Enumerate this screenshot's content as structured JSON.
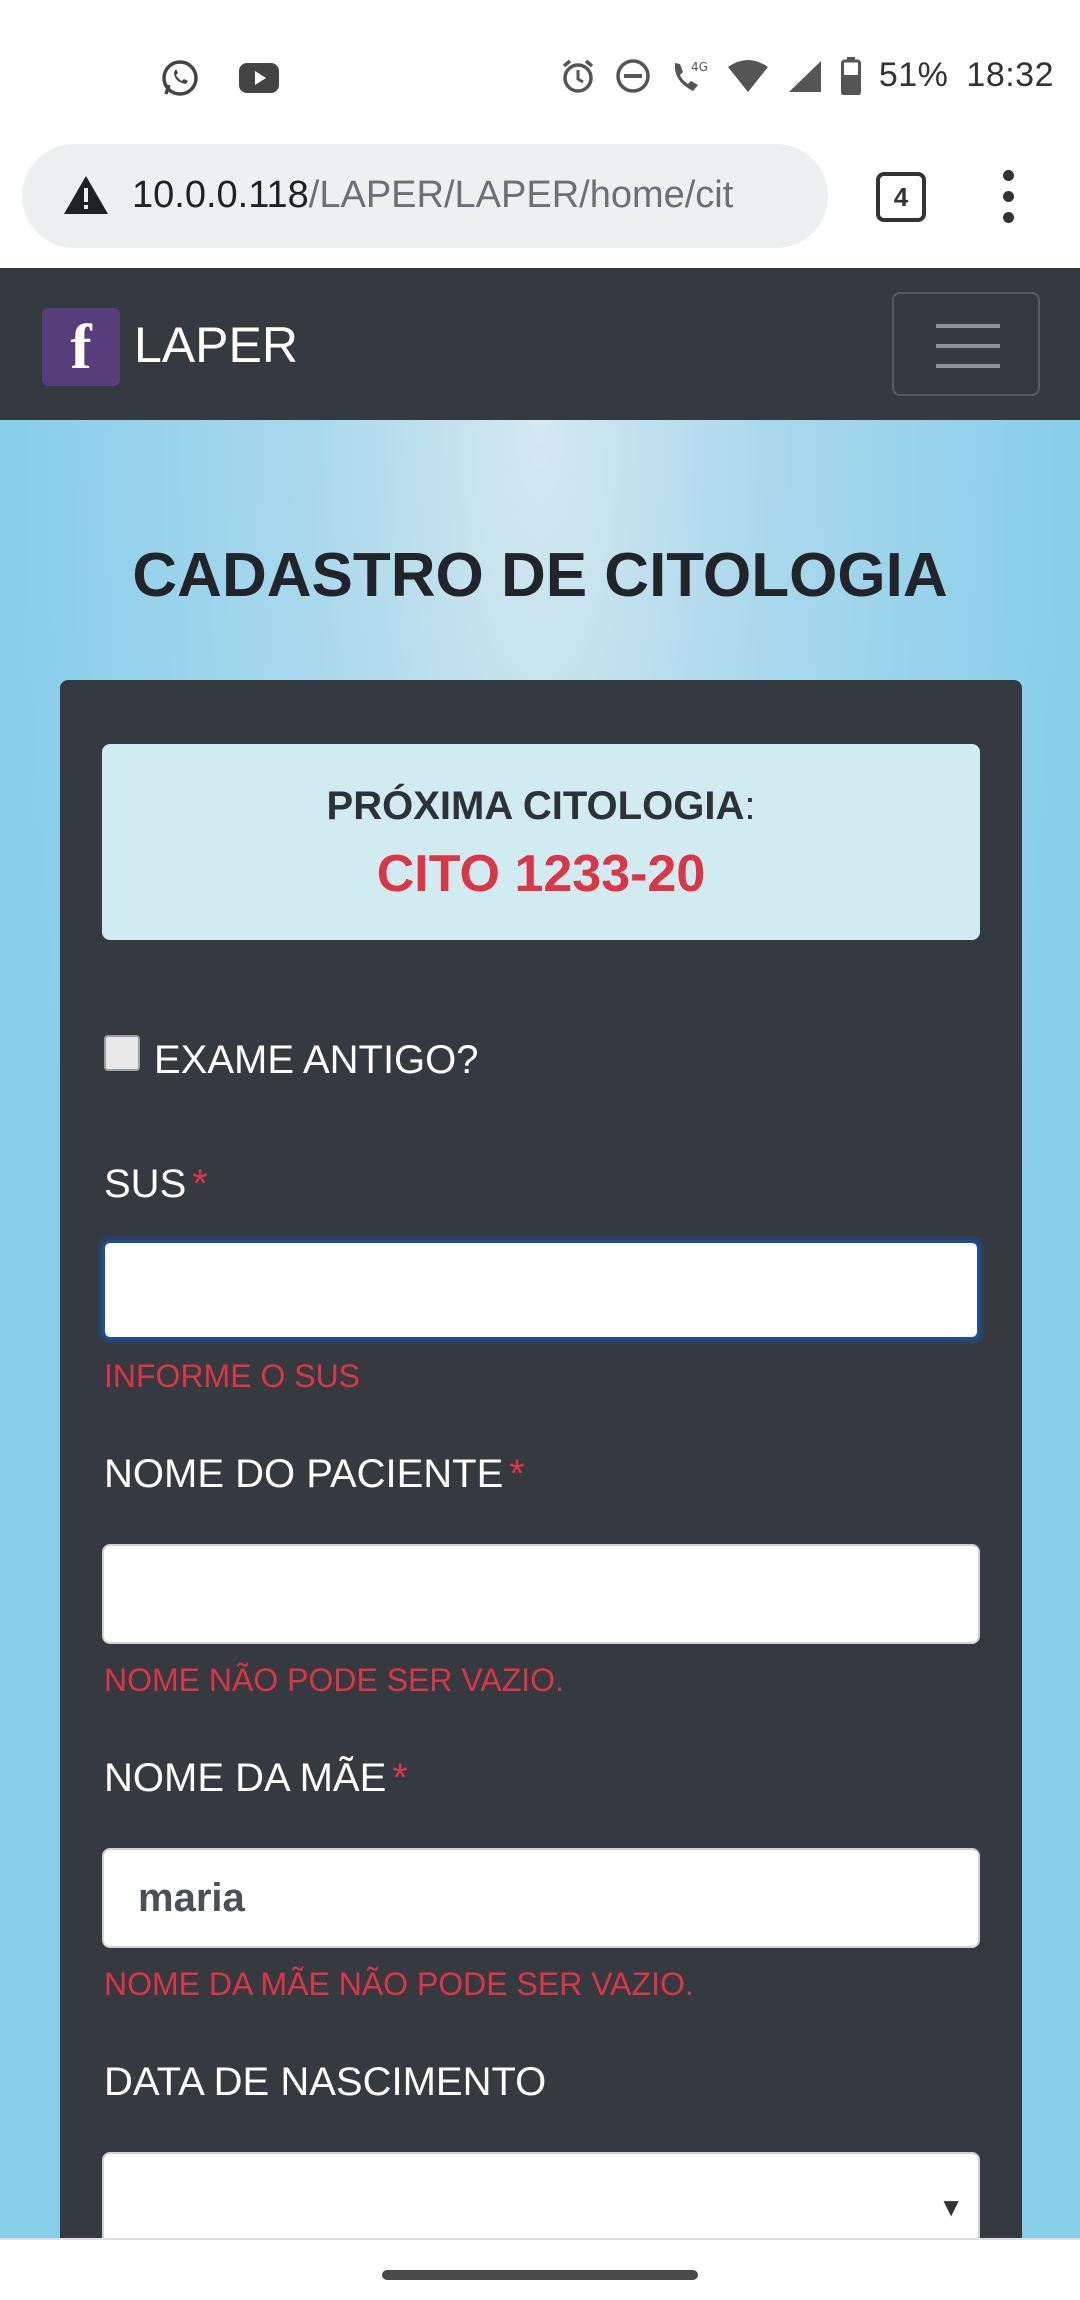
{
  "status_bar": {
    "battery": "51%",
    "time": "18:32",
    "network": "4G"
  },
  "browser": {
    "url_host": "10.0.0.118",
    "url_path": "/LAPER/LAPER/home/cit",
    "tab_count": "4"
  },
  "navbar": {
    "brand_logo": "f",
    "brand_name": "LAPER",
    "brand_color": "#563d7c"
  },
  "page": {
    "title": "CADASTRO DE CITOLOGIA"
  },
  "next_exam": {
    "label": "PRÓXIMA CITOLOGIA",
    "colon": ":",
    "value": "CITO 1233-20"
  },
  "form": {
    "old_exam_label": "EXAME ANTIGO?",
    "old_exam_checked": false,
    "required_marker": "*",
    "sus": {
      "label": "SUS",
      "value": "",
      "error": "INFORME O SUS"
    },
    "patient_name": {
      "label": "NOME DO PACIENTE",
      "value": "",
      "error": "NOME NÃO PODE SER VAZIO."
    },
    "mother_name": {
      "label": "NOME DA MÃE",
      "value": "maria",
      "error": "NOME DA MÃE NÃO PODE SER VAZIO."
    },
    "birth_date": {
      "label": "DATA DE NASCIMENTO",
      "value": ""
    }
  },
  "colors": {
    "navbar_bg": "#343a40",
    "page_bg": "#87ceeb",
    "error": "#dc3545",
    "alert_bg": "#d1ecf1"
  }
}
